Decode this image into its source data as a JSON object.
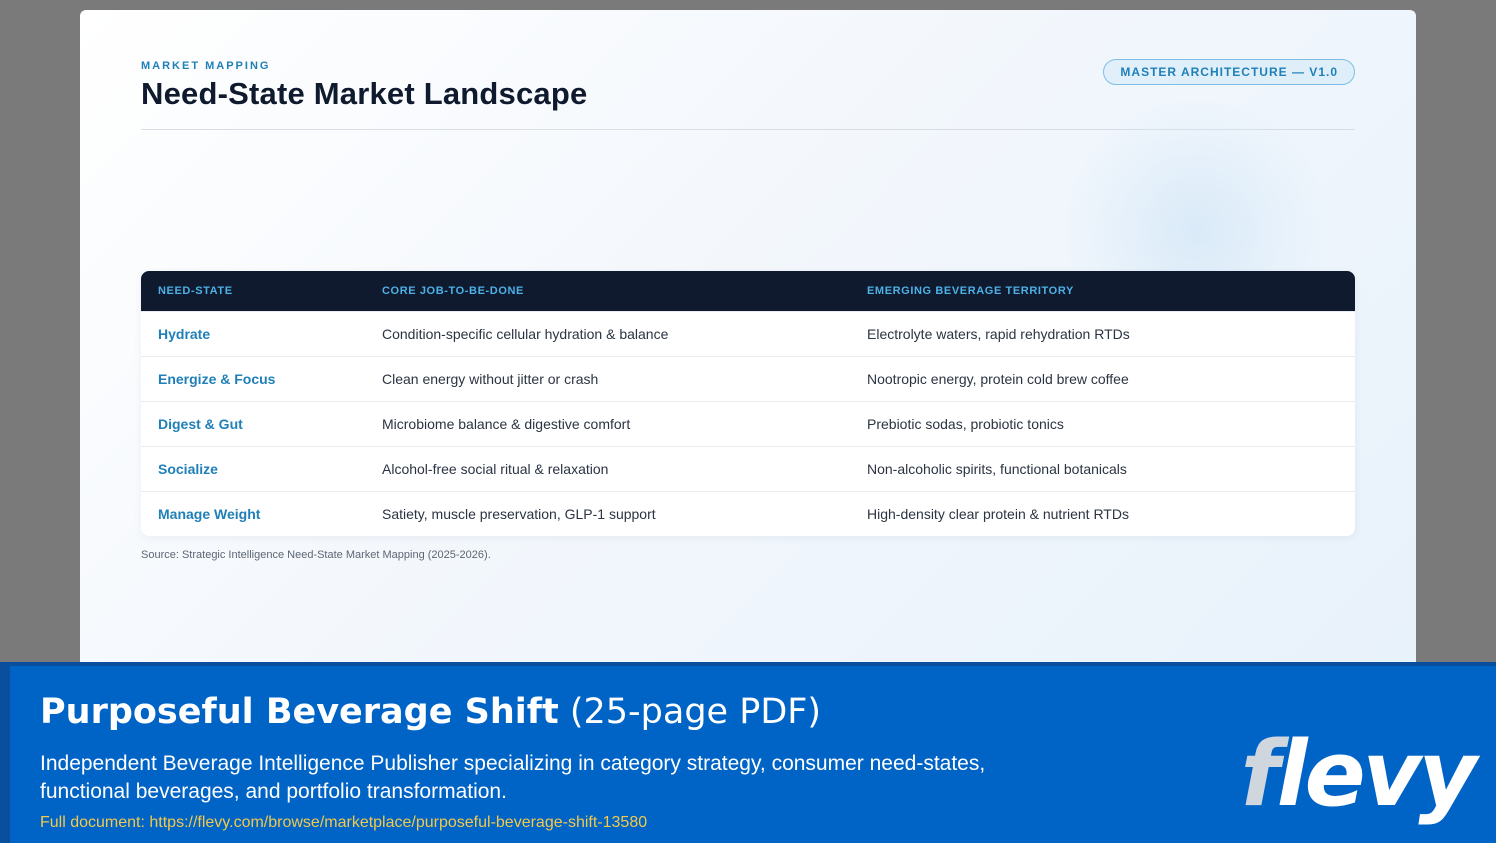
{
  "slide": {
    "eyebrow": "MARKET MAPPING",
    "title": "Need-State Market Landscape",
    "badge": "MASTER ARCHITECTURE — V1.0",
    "table": {
      "headers": [
        "NEED-STATE",
        "CORE JOB-TO-BE-DONE",
        "EMERGING BEVERAGE TERRITORY"
      ],
      "rows": [
        [
          "Hydrate",
          "Condition-specific cellular hydration & balance",
          "Electrolyte waters, rapid rehydration RTDs"
        ],
        [
          "Energize & Focus",
          "Clean energy without jitter or crash",
          "Nootropic energy, protein cold brew coffee"
        ],
        [
          "Digest & Gut",
          "Microbiome balance & digestive comfort",
          "Prebiotic sodas, probiotic tonics"
        ],
        [
          "Socialize",
          "Alcohol-free social ritual & relaxation",
          "Non-alcoholic spirits, functional botanicals"
        ],
        [
          "Manage Weight",
          "Satiety, muscle preservation, GLP-1 support",
          "High-density clear protein & nutrient RTDs"
        ]
      ]
    },
    "source": "Source: Strategic Intelligence Need-State Market Mapping (2025-2026)."
  },
  "banner": {
    "title_strong": "Purposeful Beverage Shift",
    "title_light": " (25-page PDF)",
    "description": "Independent Beverage Intelligence Publisher specializing in category strategy, consumer need-states, functional beverages, and portfolio transformation.",
    "link": "Full document: https://flevy.com/browse/marketplace/purposeful-beverage-shift-13580",
    "logo_first": "f",
    "logo_rest": "levy"
  },
  "colors": {
    "accent": "#1f7fb8",
    "header_bg": "#0f1a2e",
    "banner_bg": "#0063c6",
    "link": "#f2c94c"
  }
}
